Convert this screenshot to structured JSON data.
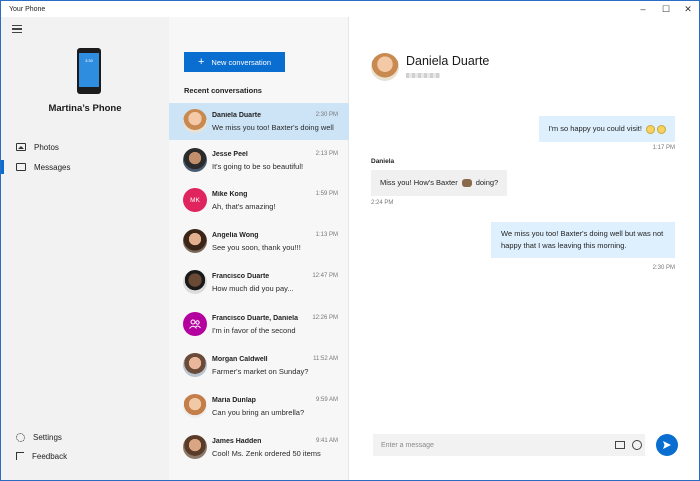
{
  "window": {
    "title": "Your Phone",
    "minimize": "–",
    "maximize": "☐",
    "close": "✕"
  },
  "nav": {
    "phone_name": "Martina’s Phone",
    "phone_screen_text": "3:30",
    "items": [
      {
        "label": "Photos",
        "icon": "photos-icon"
      },
      {
        "label": "Messages",
        "icon": "messages-icon",
        "active": true
      }
    ],
    "bottom_items": [
      {
        "label": "Settings",
        "icon": "gear-icon"
      },
      {
        "label": "Feedback",
        "icon": "feedback-icon"
      }
    ]
  },
  "conversations": {
    "new_button": "New conversation",
    "new_button_icon": "+",
    "section_title": "Recent conversations",
    "items": [
      {
        "name": "Daniela Duarte",
        "time": "2:30 PM",
        "preview": "We miss you too! Baxter's doing well",
        "selected": true,
        "avatar": ""
      },
      {
        "name": "Jesse Peel",
        "time": "2:13 PM",
        "preview": "It's going to be so beautiful!",
        "avatar": ""
      },
      {
        "name": "Mike Kong",
        "time": "1:59 PM",
        "preview": "Ah, that's amazing!",
        "avatar": "MK"
      },
      {
        "name": "Angelia Wong",
        "time": "1:13 PM",
        "preview": "See you soon, thank you!!!",
        "avatar": ""
      },
      {
        "name": "Francisco Duarte",
        "time": "12:47 PM",
        "preview": "How much did you pay...",
        "avatar": ""
      },
      {
        "name": "Francisco Duarte, Daniela",
        "time": "12:26 PM",
        "preview": "I'm in favor of the second",
        "avatar": ""
      },
      {
        "name": "Morgan Caldwell",
        "time": "11:52 AM",
        "preview": "Farmer's market on Sunday?",
        "avatar": ""
      },
      {
        "name": "Maria Dunlap",
        "time": "9:59 AM",
        "preview": "Can you bring an umbrella?",
        "avatar": ""
      },
      {
        "name": "James Hadden",
        "time": "9:41 AM",
        "preview": "Cool! Ms. Zenk ordered 50 items",
        "avatar": ""
      }
    ]
  },
  "chat": {
    "contact_name": "Daniela Duarte",
    "messages": [
      {
        "direction": "out",
        "text": "I'm so happy you could visit!",
        "time": "1:17 PM"
      },
      {
        "direction": "in",
        "sender": "Daniela",
        "text_before": "Miss you! How's Baxter",
        "text_after": "doing?",
        "time": "2:24 PM"
      },
      {
        "direction": "out",
        "text": "We miss you too! Baxter's doing well but was not happy that I was leaving this morning.",
        "time": "2:30 PM"
      }
    ],
    "compose_placeholder": "Enter a message",
    "colors": {
      "accent": "#0a6ed1",
      "selected_row": "#cde4f7",
      "outgoing_bubble": "#deeffd",
      "incoming_bubble": "#f0f0f0"
    }
  }
}
